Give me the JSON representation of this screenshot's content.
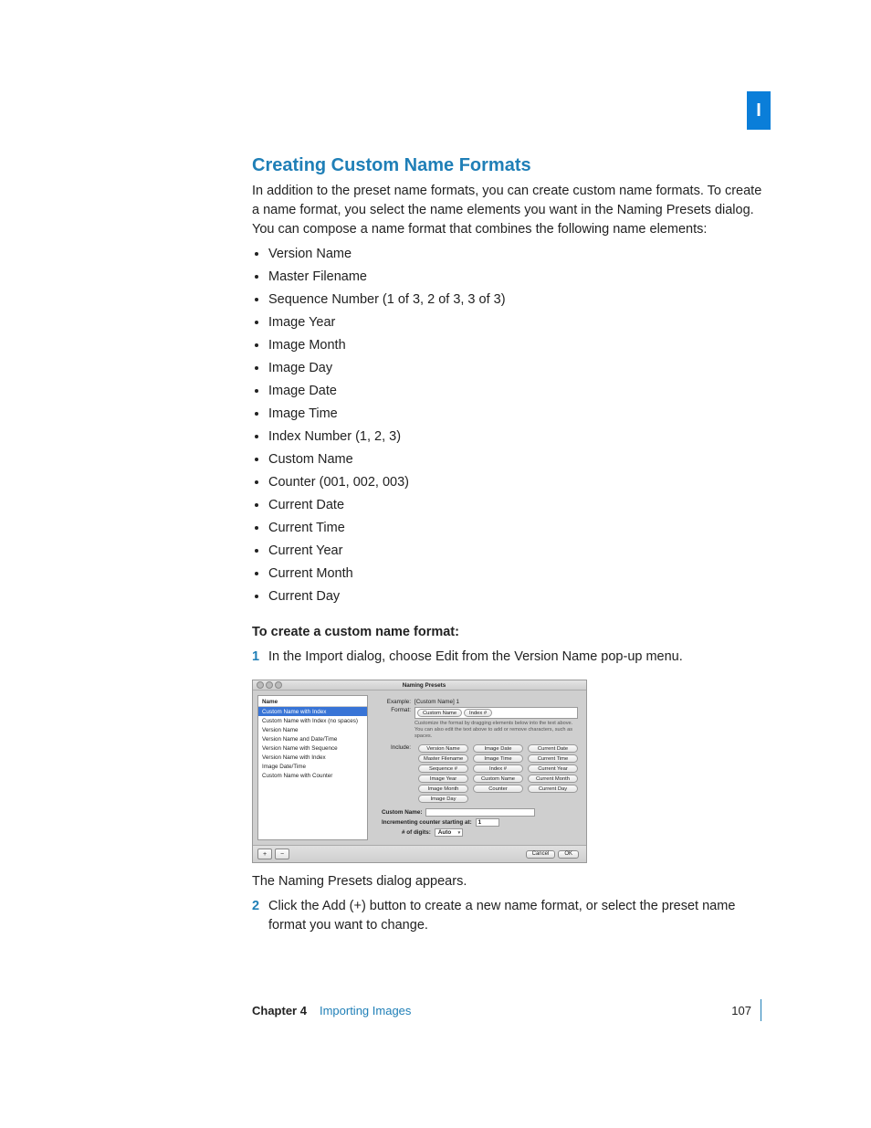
{
  "tab_label": "I",
  "heading": "Creating Custom Name Formats",
  "intro": "In addition to the preset name formats, you can create custom name formats. To create a name format, you select the name elements you want in the Naming Presets dialog. You can compose a name format that combines the following name elements:",
  "bullets": [
    "Version Name",
    "Master Filename",
    "Sequence Number (1 of 3, 2 of 3, 3 of 3)",
    "Image Year",
    "Image Month",
    "Image Day",
    "Image Date",
    "Image Time",
    "Index Number (1, 2, 3)",
    "Custom Name",
    "Counter (001, 002, 003)",
    "Current Date",
    "Current Time",
    "Current Year",
    "Current Month",
    "Current Day"
  ],
  "task_heading": "To create a custom name format:",
  "step1_num": "1",
  "step1_text": "In the Import dialog, choose Edit from the Version Name pop-up menu.",
  "after_dialog": "The Naming Presets dialog appears.",
  "step2_num": "2",
  "step2_text": "Click the Add (+) button to create a new name format, or select the preset name format you want to change.",
  "dialog": {
    "title": "Naming Presets",
    "sidebar_header": "Name",
    "sidebar_items": [
      "Custom Name with Index",
      "Custom Name with Index (no spaces)",
      "Version Name",
      "Version Name and Date/Time",
      "Version Name with Sequence",
      "Version Name with Index",
      "Image Date/Time",
      "Custom Name with Counter"
    ],
    "example_label": "Example:",
    "example_value": "[Custom Name] 1",
    "format_label": "Format:",
    "format_tokens": [
      "Custom Name",
      "Index #"
    ],
    "hint": "Customize the format by dragging elements below into the text above. You can also edit the text above to add or remove characters, such as spaces.",
    "include_label": "Include:",
    "include_tokens": [
      "Version Name",
      "Image Date",
      "Current Date",
      "Master Filename",
      "Image Time",
      "Current Time",
      "Sequence #",
      "Index #",
      "Current Year",
      "Image Year",
      "Custom Name",
      "Current Month",
      "Image Month",
      "Counter",
      "Current Day",
      "Image Day",
      "",
      ""
    ],
    "custom_name_label": "Custom Name:",
    "counter_label": "Incrementing counter starting at:",
    "counter_value": "1",
    "digits_label": "# of digits:",
    "digits_value": "Auto",
    "add_btn": "+",
    "remove_btn": "−",
    "cancel": "Cancel",
    "ok": "OK"
  },
  "footer": {
    "chapter": "Chapter 4",
    "chapter_title": "Importing Images",
    "page_number": "107"
  }
}
